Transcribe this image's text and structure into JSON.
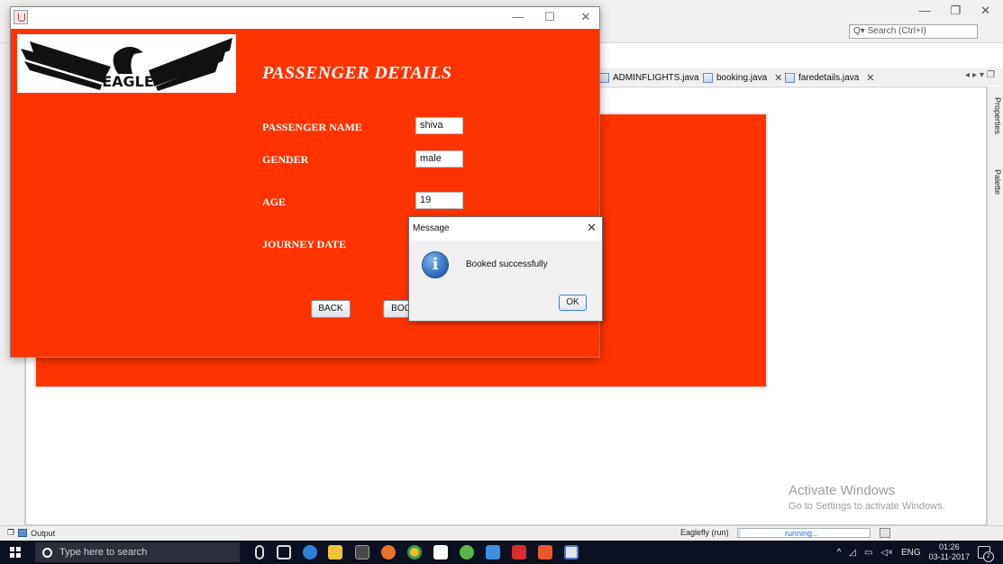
{
  "ide": {
    "search_placeholder": "Search (Ctrl+I)",
    "search_icon_glyph": "Q",
    "tabs": [
      {
        "label": "ADMINFLIGHTS.java"
      },
      {
        "label": "booking.java"
      },
      {
        "label": "faredetails.java"
      }
    ],
    "right_tabs": [
      "Properties",
      "Palette"
    ],
    "output_tab_label": "Output",
    "run_label": "Eaglefly (run)",
    "run_status": "running...",
    "watermark_title": "Activate Windows",
    "watermark_subtitle": "Go to Settings to activate Windows.",
    "design_panel_color": "#ff3300"
  },
  "app": {
    "window_color": "#ff3300",
    "logo_text": "EAGLE",
    "title": "PASSENGER DETAILS",
    "fields": {
      "passenger_name": {
        "label": "PASSENGER NAME",
        "value": "shiva"
      },
      "gender": {
        "label": "GENDER",
        "value": "male"
      },
      "age": {
        "label": "AGE",
        "value": "19"
      },
      "journey_date": {
        "label": "JOURNEY DATE"
      }
    },
    "back_label": "BACK",
    "book_label": "BOC"
  },
  "dialog": {
    "title": "Message",
    "message": "Booked successfully",
    "ok_label": "OK",
    "icon": "info-icon"
  },
  "taskbar": {
    "search_placeholder": "Type here to search",
    "language": "ENG",
    "time": "01:26",
    "date": "03-11-2017",
    "notification_count": "2"
  }
}
